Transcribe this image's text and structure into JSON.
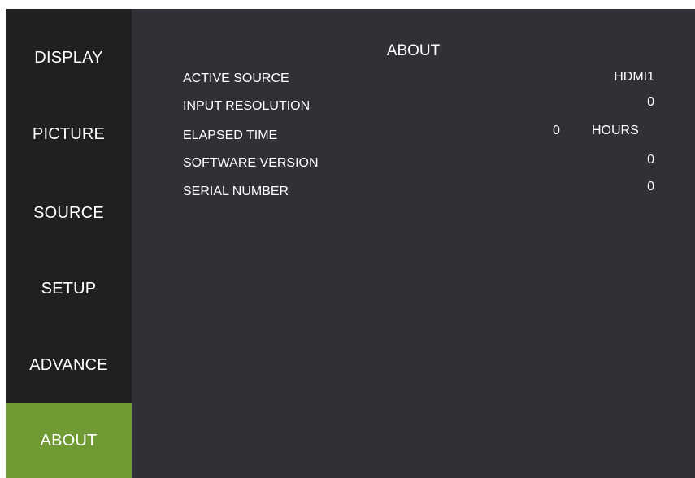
{
  "sidebar": {
    "items": [
      {
        "label": "DISPLAY",
        "active": false
      },
      {
        "label": "PICTURE",
        "active": false
      },
      {
        "label": "SOURCE",
        "active": false
      },
      {
        "label": "SETUP",
        "active": false
      },
      {
        "label": "ADVANCE",
        "active": false
      },
      {
        "label": "ABOUT",
        "active": true
      }
    ]
  },
  "panel": {
    "title": "ABOUT",
    "rows": [
      {
        "label": "ACTIVE SOURCE",
        "value": "HDMI1"
      },
      {
        "label": "INPUT RESOLUTION",
        "value": "0"
      },
      {
        "label": "ELAPSED TIME",
        "value": "0",
        "unit": "HOURS"
      },
      {
        "label": "SOFTWARE VERSION",
        "value": "0"
      },
      {
        "label": "SERIAL NUMBER",
        "value": "0"
      }
    ]
  },
  "colors": {
    "active_tab": "#6f9a34",
    "sidebar_bg": "#202020",
    "panel_bg": "#303036",
    "text": "#ffffff"
  }
}
